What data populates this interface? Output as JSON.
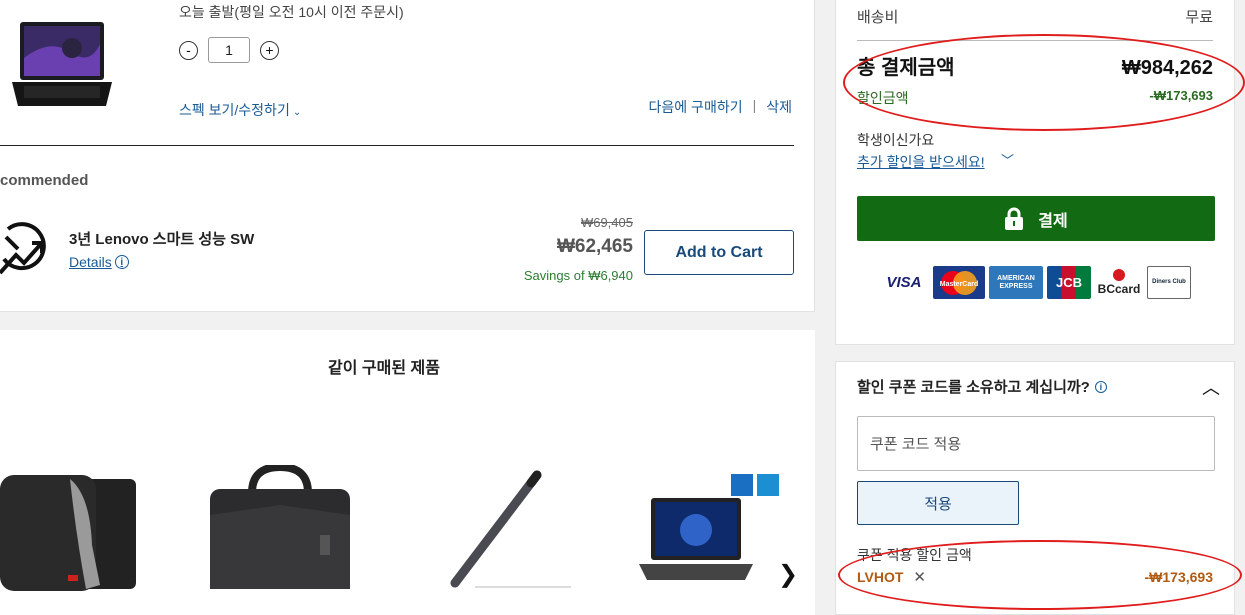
{
  "cart_item": {
    "shipping_note": "오늘 출발(평일 오전 10시 이전 주문시)",
    "quantity": "1",
    "qty_minus": "-",
    "qty_plus": "+",
    "spec_link": "스펙 보기/수정하기",
    "buy_later": "다음에 구매하기",
    "separator": "|",
    "delete": "삭제"
  },
  "recommended": {
    "heading": "commended",
    "title": "3년 Lenovo 스마트 성능 SW",
    "details": "Details",
    "old_price": "₩69,405",
    "new_price": "₩62,465",
    "savings": "Savings of ₩6,940",
    "add_to_cart": "Add to Cart"
  },
  "bought_together": {
    "title": "같이 구매된 제품"
  },
  "summary": {
    "shipping_label": "배송비",
    "shipping_value": "무료",
    "total_label": "총 결제금액",
    "total_value": "₩984,262",
    "discount_label": "할인금액",
    "discount_value": "-₩173,693",
    "student_label": "학생이신가요",
    "student_link": "추가 할인을 받으세요!",
    "checkout_label": "결제",
    "payment_logos": [
      "VISA",
      "MasterCard",
      "AMERICAN EXPRESS",
      "JCB",
      "BCcard",
      "Diners Club"
    ]
  },
  "coupon": {
    "question": "할인 쿠폰 코드를 소유하고 계십니까?",
    "input_placeholder": "쿠폰 코드 적용",
    "apply_label": "적용",
    "applied_label": "쿠폰 적용 할인 금액",
    "code": "LVHOT",
    "remove": "✕",
    "amount": "-₩173,693"
  },
  "colors": {
    "checkout_green": "#126b12",
    "link_blue": "#1a5b96",
    "coupon_orange": "#b05a12",
    "annotation_red": "#e01c1c"
  }
}
